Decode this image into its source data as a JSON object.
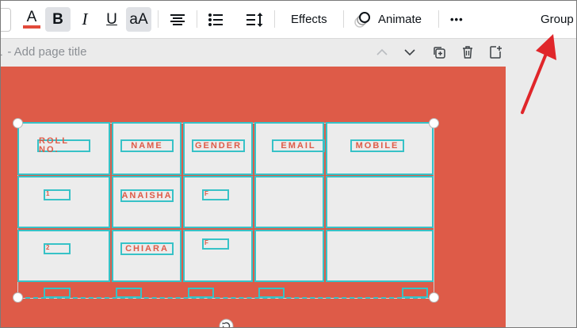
{
  "toolbar": {
    "font_color_glyph": "A",
    "bold_glyph": "B",
    "italic_glyph": "I",
    "underline_glyph": "U",
    "case_glyph": "aA",
    "effects_label": "Effects",
    "animate_label": "Animate",
    "more_glyph": "•••",
    "group_label": "Group",
    "font_color": "#e24a3b"
  },
  "page": {
    "title_placeholder": "- Add page title",
    "title_prefix": "1"
  },
  "table": {
    "headers": [
      "ROLL NO.",
      "NAME",
      "GENDER",
      "EMAIL",
      "MOBILE"
    ],
    "rows": [
      [
        "1",
        "ANAISHA",
        "F",
        "",
        ""
      ],
      [
        "2",
        "CHIARA",
        "F",
        "",
        ""
      ]
    ]
  },
  "colors": {
    "canvas": "#de5b48",
    "cell_border": "#37c2c7",
    "arrow": "#e0262a"
  },
  "icons": [
    "font-color-icon",
    "bold-icon",
    "italic-icon",
    "underline-icon",
    "case-icon",
    "align-center-icon",
    "bullet-list-icon",
    "line-spacing-icon",
    "animate-icon",
    "more-icon",
    "chevron-up-icon",
    "chevron-down-icon",
    "duplicate-page-icon",
    "delete-page-icon",
    "add-page-icon",
    "rotate-icon",
    "annotation-arrow"
  ]
}
